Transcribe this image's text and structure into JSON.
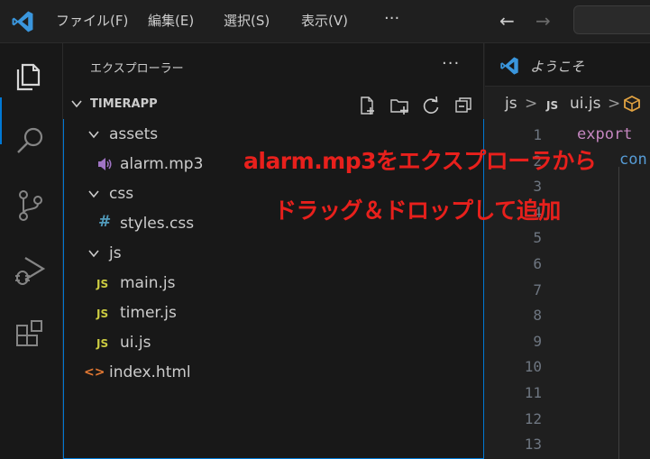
{
  "titlebar": {
    "menu": [
      "ファイル(F)",
      "編集(E)",
      "選択(S)",
      "表示(V)",
      "···"
    ],
    "back_arrow": "←",
    "forward_arrow": "→"
  },
  "explorer": {
    "title": "エクスプローラー",
    "more": "···",
    "project": "TIMERAPP",
    "tree": [
      {
        "label": "assets",
        "type": "folder"
      },
      {
        "label": "alarm.mp3",
        "type": "audio"
      },
      {
        "label": "css",
        "type": "folder"
      },
      {
        "label": "styles.css",
        "type": "css",
        "icon": "#"
      },
      {
        "label": "js",
        "type": "folder"
      },
      {
        "label": "main.js",
        "type": "js",
        "icon": "JS"
      },
      {
        "label": "timer.js",
        "type": "js",
        "icon": "JS"
      },
      {
        "label": "ui.js",
        "type": "js",
        "icon": "JS"
      },
      {
        "label": "index.html",
        "type": "html",
        "icon": "<>"
      }
    ]
  },
  "editor": {
    "tab_label": "ようこそ",
    "breadcrumb": {
      "folder": "js",
      "sep": ">",
      "file_icon": "JS",
      "file": "ui.js"
    },
    "line_numbers": [
      "1",
      "2",
      "3",
      "4",
      "5",
      "6",
      "7",
      "8",
      "9",
      "10",
      "11",
      "12",
      "13"
    ],
    "code": {
      "line1": "export",
      "line2": "con"
    }
  },
  "annotation": {
    "line1": "alarm.mp3をエクスプローラから",
    "line2": "ドラッグ＆ドロップして追加"
  },
  "colors": {
    "accent": "#0078d4",
    "annotation_red": "#e8201c",
    "js_yellow": "#cbcb41",
    "css_blue": "#519aba",
    "html_orange": "#e37933",
    "keyword_purple": "#c586c0",
    "keyword_blue": "#569cd6"
  }
}
